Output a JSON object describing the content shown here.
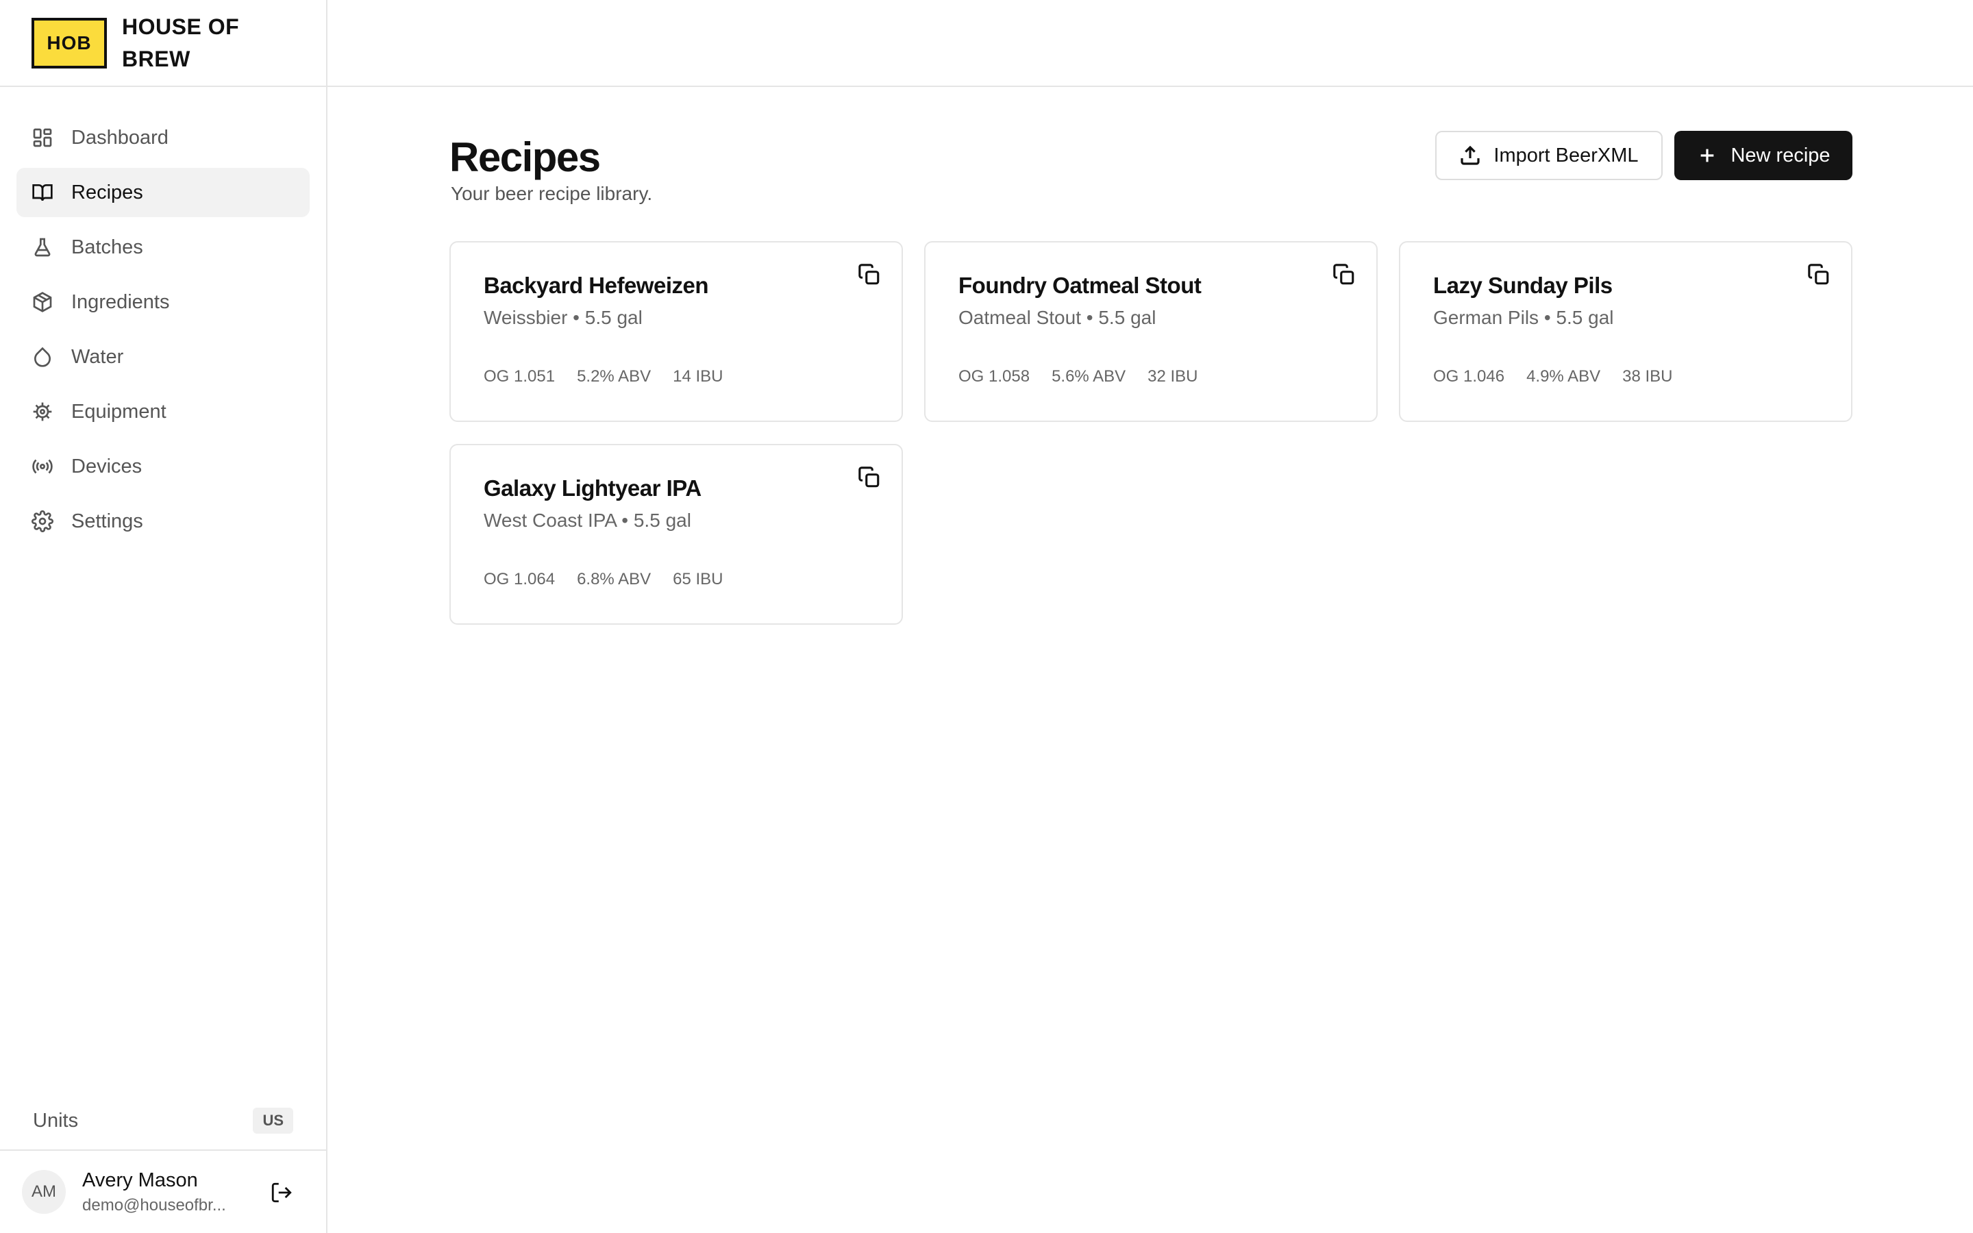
{
  "brand": {
    "logo_text": "HOB",
    "name": "HOUSE OF BREW"
  },
  "nav": [
    {
      "label": "Dashboard",
      "icon": "dashboard-icon",
      "active": false
    },
    {
      "label": "Recipes",
      "icon": "book-icon",
      "active": true
    },
    {
      "label": "Batches",
      "icon": "flask-icon",
      "active": false
    },
    {
      "label": "Ingredients",
      "icon": "package-icon",
      "active": false
    },
    {
      "label": "Water",
      "icon": "droplet-icon",
      "active": false
    },
    {
      "label": "Equipment",
      "icon": "cog-icon",
      "active": false
    },
    {
      "label": "Devices",
      "icon": "radio-icon",
      "active": false
    },
    {
      "label": "Settings",
      "icon": "settings-icon",
      "active": false
    }
  ],
  "units": {
    "label": "Units",
    "value": "US"
  },
  "user": {
    "initials": "AM",
    "name": "Avery Mason",
    "email": "demo@houseofbr..."
  },
  "page": {
    "title": "Recipes",
    "subtitle": "Your beer recipe library."
  },
  "actions": {
    "import_label": "Import BeerXML",
    "new_label": "New recipe"
  },
  "recipes": [
    {
      "name": "Backyard Hefeweizen",
      "style": "Weissbier",
      "volume": "5.5 gal",
      "og": "OG 1.051",
      "abv": "5.2% ABV",
      "ibu": "14 IBU"
    },
    {
      "name": "Foundry Oatmeal Stout",
      "style": "Oatmeal Stout",
      "volume": "5.5 gal",
      "og": "OG 1.058",
      "abv": "5.6% ABV",
      "ibu": "32 IBU"
    },
    {
      "name": "Lazy Sunday Pils",
      "style": "German Pils",
      "volume": "5.5 gal",
      "og": "OG 1.046",
      "abv": "4.9% ABV",
      "ibu": "38 IBU"
    },
    {
      "name": "Galaxy Lightyear IPA",
      "style": "West Coast IPA",
      "volume": "5.5 gal",
      "og": "OG 1.064",
      "abv": "6.8% ABV",
      "ibu": "65 IBU"
    }
  ],
  "colors": {
    "brand_yellow": "#fbdc3c",
    "primary_button": "#141414",
    "active_nav_bg": "#f2f2f2"
  }
}
